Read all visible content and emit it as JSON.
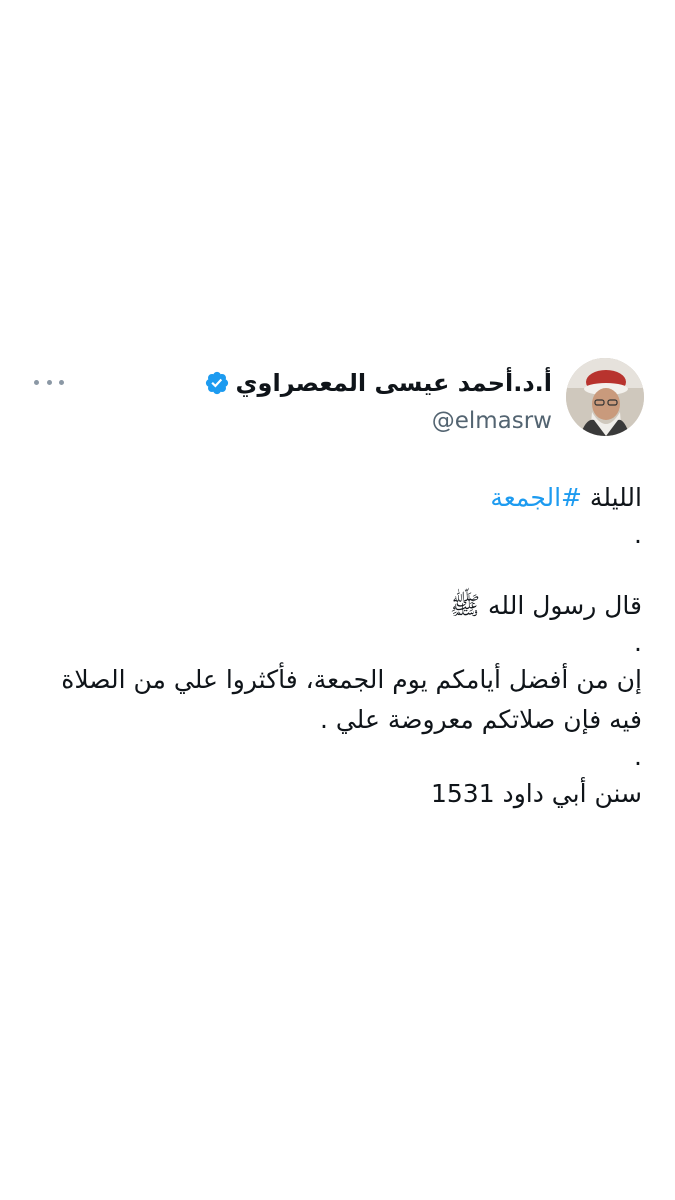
{
  "tweet": {
    "author": {
      "display_name": "أ.د.أحمد عيسى المعصراوي",
      "handle": "@elmasrw",
      "verified": true,
      "verified_color": "#1d9bf0"
    },
    "more_icon": "more-horizontal-icon",
    "body": {
      "line1_prefix": "الليلة ",
      "hashtag": "#الجمعة",
      "dot1": ".",
      "line2": "قال رسول الله ﷺ",
      "dot2": ".",
      "line3": "إن من أفضل أيامكم يوم الجمعة، فأكثروا علي من الصلاة",
      "line4": "فيه فإن صلاتكم معروضة علي .",
      "dot3": ".",
      "line5": "سنن أبي داود 1531"
    }
  },
  "colors": {
    "text": "#0f1419",
    "secondary": "#536471",
    "link": "#1d9bf0"
  }
}
